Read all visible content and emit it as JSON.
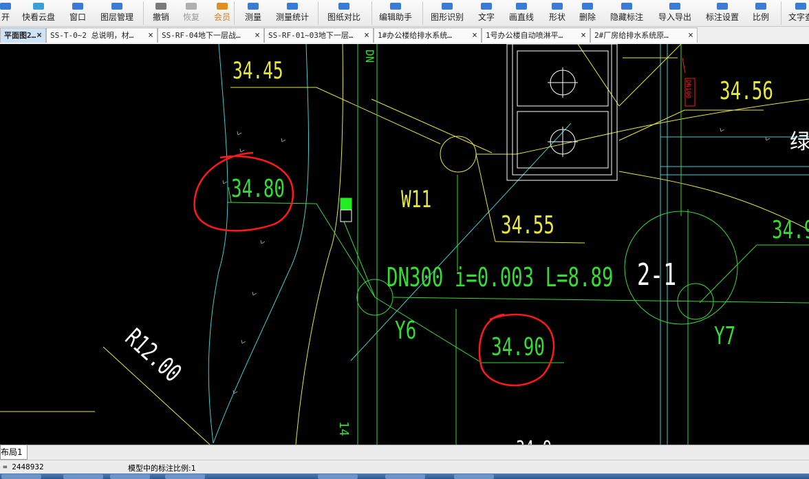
{
  "toolbar": {
    "items": [
      {
        "label": "开",
        "icon": "open-icon"
      },
      {
        "label": "快看云盘",
        "icon": "cloud-icon"
      },
      {
        "label": "窗口",
        "icon": "window-icon"
      },
      {
        "label": "图层管理",
        "icon": "layers-icon"
      },
      {
        "label": "撤销",
        "icon": "undo-icon"
      },
      {
        "label": "恢复",
        "icon": "redo-icon"
      },
      {
        "label": "会员",
        "icon": "vip-icon"
      },
      {
        "label": "测量",
        "icon": "ruler-icon"
      },
      {
        "label": "测量统计",
        "icon": "measure-stats-icon"
      },
      {
        "label": "图纸对比",
        "icon": "compare-icon"
      },
      {
        "label": "编辑助手",
        "icon": "edit-helper-icon"
      },
      {
        "label": "图形识别",
        "icon": "recognize-icon"
      },
      {
        "label": "文字",
        "icon": "text-icon"
      },
      {
        "label": "画直线",
        "icon": "line-icon"
      },
      {
        "label": "形状",
        "icon": "shape-icon"
      },
      {
        "label": "删除",
        "icon": "eraser-icon"
      },
      {
        "label": "隐藏标注",
        "icon": "hide-annotation-icon"
      },
      {
        "label": "导入导出",
        "icon": "import-export-icon"
      },
      {
        "label": "标注设置",
        "icon": "annotation-settings-icon"
      },
      {
        "label": "比例",
        "icon": "scale-icon"
      },
      {
        "label": "文字查",
        "icon": "text-search-icon"
      }
    ],
    "vip_badge": "VIP"
  },
  "tabs": [
    {
      "label": "平面图2…",
      "active": true
    },
    {
      "label": "SS-T-0~2 总说明，材…"
    },
    {
      "label": "SS-RF-04地下一层战…"
    },
    {
      "label": "SS-RF-01~03地下一层…"
    },
    {
      "label": "1#办公楼给排水系统…"
    },
    {
      "label": "1号办公楼自动喷淋平…"
    },
    {
      "label": "2#厂房给排水系统原…"
    }
  ],
  "drawing": {
    "labels": {
      "elev_top_left": "34.45",
      "elev_top_right": "34.56",
      "elev_circled_left": "34.80",
      "elev_mid": "34.55",
      "elev_circled_right": "34.90",
      "elev_right": "34.9",
      "elev_bottom_partial": "34.9",
      "pipe_spec": "DN300 i=0.003 L=8.89",
      "well_w11": "W11",
      "node_y6": "Y6",
      "node_y7": "Y7",
      "section_2_1": "2-1",
      "radius": "R12.00",
      "green_char": "绿",
      "dn_vertical": "DN",
      "red_vertical": "DN100",
      "bottom_vertical": "14"
    },
    "colors": {
      "yellow": "#e8e83a",
      "green": "#33dd33",
      "cyan": "#3ad0d0",
      "white": "#ffffff",
      "red": "#ff1a1a",
      "gray": "#9a9a9a"
    }
  },
  "layout_tab": "布局1",
  "status": {
    "coord": "= 2448932",
    "scale": "模型中的标注比例:1"
  }
}
